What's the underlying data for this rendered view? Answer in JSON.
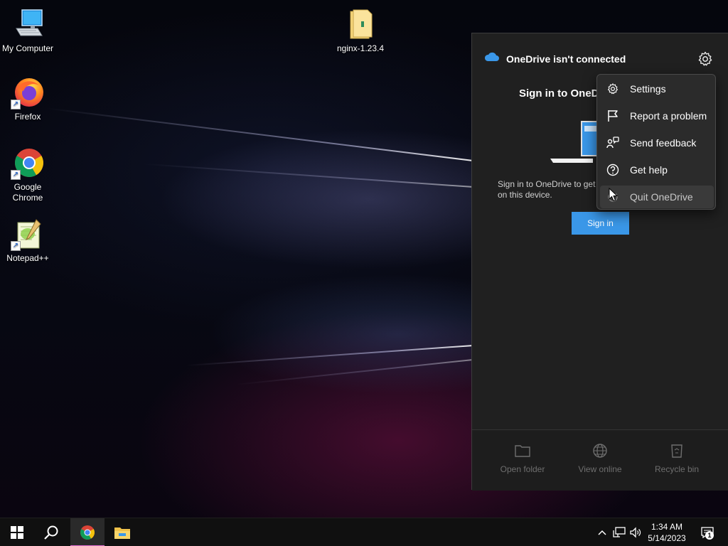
{
  "desktop": {
    "icons": [
      {
        "label": "My Computer"
      },
      {
        "label": "Firefox"
      },
      {
        "label": "Google Chrome"
      },
      {
        "label": "Notepad++"
      },
      {
        "label": "nginx-1.23.4"
      }
    ]
  },
  "onedrive": {
    "title": "OneDrive isn't connected",
    "signin_heading": "Sign in to OneD",
    "description": "Sign in to OneDrive to get on this device.",
    "signin_button": "Sign in",
    "footer": [
      {
        "label": "Open folder",
        "icon": "folder-icon"
      },
      {
        "label": "View online",
        "icon": "globe-icon"
      },
      {
        "label": "Recycle bin",
        "icon": "recycle-bin-icon"
      }
    ]
  },
  "context_menu": {
    "items": [
      {
        "label": "Settings",
        "icon": "gear-icon"
      },
      {
        "label": "Report a problem",
        "icon": "flag-icon"
      },
      {
        "label": "Send feedback",
        "icon": "feedback-icon"
      },
      {
        "label": "Get help",
        "icon": "help-icon"
      },
      {
        "label": "Quit OneDrive",
        "icon": "quit-icon",
        "hovered": true
      }
    ]
  },
  "taskbar": {
    "clock_time": "1:34 AM",
    "clock_date": "5/14/2023",
    "notification_count": "1"
  },
  "colors": {
    "accent": "#3a97e8",
    "panel_bg": "#202020",
    "menu_bg": "#2b2b2b",
    "taskbar_bg": "#101010"
  }
}
